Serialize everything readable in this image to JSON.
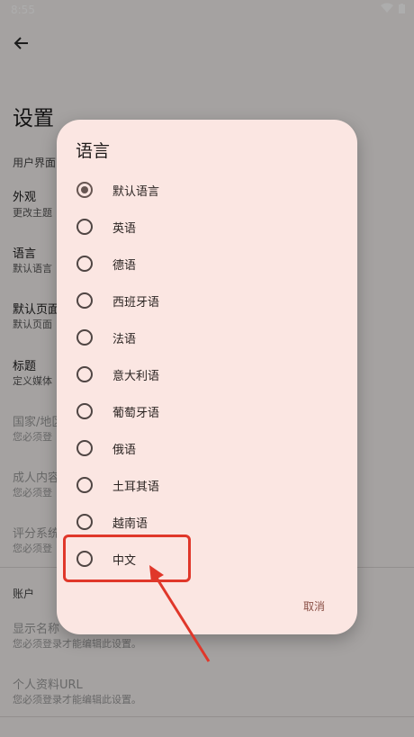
{
  "status_bar": {
    "time": "8:55"
  },
  "page": {
    "title": "设置",
    "section_ui": "用户界面",
    "settings": [
      {
        "title": "外观",
        "subtitle": "更改主题"
      },
      {
        "title": "语言",
        "subtitle": "默认语言"
      },
      {
        "title": "默认页面",
        "subtitle": "默认页面"
      },
      {
        "title": "标题",
        "subtitle": "定义媒体"
      },
      {
        "title": "国家/地区",
        "subtitle": "您必须登"
      },
      {
        "title": "成人内容",
        "subtitle": "您必须登"
      },
      {
        "title": "评分系统",
        "subtitle": "您必须登"
      }
    ],
    "section_account": "账户",
    "account_settings": [
      {
        "title": "显示名称",
        "subtitle": "您必须登录才能编辑此设置。"
      },
      {
        "title": "个人资料URL",
        "subtitle": "您必须登录才能编辑此设置。"
      }
    ]
  },
  "dialog": {
    "title": "语言",
    "options": [
      {
        "label": "默认语言",
        "selected": true
      },
      {
        "label": "英语"
      },
      {
        "label": "德语"
      },
      {
        "label": "西班牙语"
      },
      {
        "label": "法语"
      },
      {
        "label": "意大利语"
      },
      {
        "label": "葡萄牙语"
      },
      {
        "label": "俄语"
      },
      {
        "label": "土耳其语"
      },
      {
        "label": "越南语"
      },
      {
        "label": "中文"
      }
    ],
    "cancel_label": "取消"
  },
  "colors": {
    "dialog_bg": "#fbe6e2",
    "accent": "#8a4f45",
    "annotation": "#e0372a"
  }
}
